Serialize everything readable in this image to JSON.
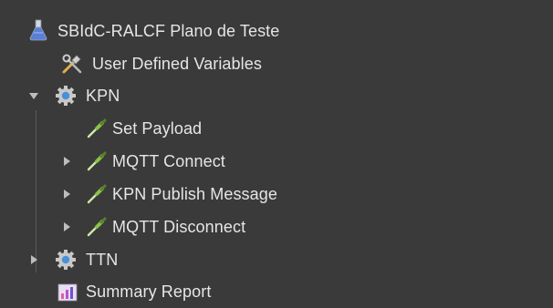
{
  "tree": {
    "nodes": [
      {
        "label": "SBIdC-RALCF Plano de Teste",
        "icon": "flask-icon",
        "expanded": true
      },
      {
        "label": "User Defined Variables",
        "icon": "tools-icon"
      },
      {
        "label": "KPN",
        "icon": "gear-icon",
        "expanded": true
      },
      {
        "label": "Set Payload",
        "icon": "pipette-icon"
      },
      {
        "label": "MQTT Connect",
        "icon": "pipette-icon",
        "expanded": false
      },
      {
        "label": "KPN Publish Message",
        "icon": "pipette-icon",
        "expanded": false
      },
      {
        "label": "MQTT Disconnect",
        "icon": "pipette-icon",
        "expanded": false
      },
      {
        "label": "TTN",
        "icon": "gear-icon",
        "expanded": false
      },
      {
        "label": "Summary Report",
        "icon": "report-chart-icon"
      }
    ]
  },
  "colors": {
    "background": "#3a3a3a",
    "text": "#e6e6e6",
    "arrow": "#bdbdbd",
    "guide_line": "#5a5a5a",
    "gear": "#c8c8c8",
    "gear_center": "#4a90d9",
    "pipette_green": "#8bc34a",
    "flask_blue": "#5b7fd6"
  }
}
